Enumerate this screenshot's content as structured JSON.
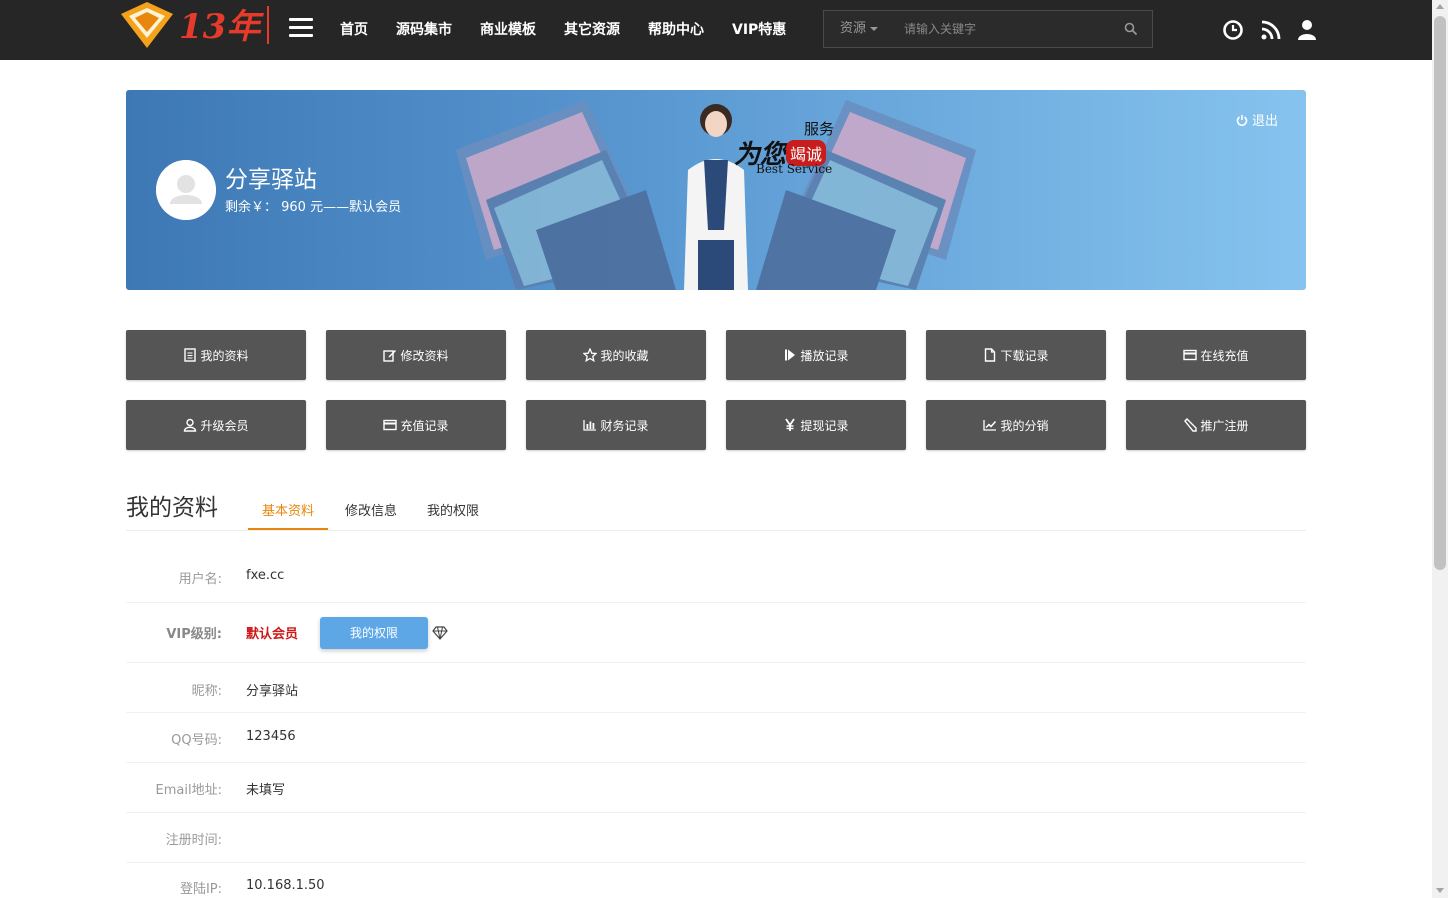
{
  "header": {
    "logo_text": "13年",
    "nav": [
      "首页",
      "源码集市",
      "商业模板",
      "其它资源",
      "帮助中心",
      "VIP特惠"
    ],
    "search": {
      "category": "资源",
      "placeholder": "请输入关键字"
    }
  },
  "banner": {
    "user_name": "分享驿站",
    "balance_text": "剩余￥： 960 元——默认会员",
    "logout_label": "退出",
    "slogan_line1": "服务",
    "slogan_line2": "为您",
    "slogan_badge": "竭诚",
    "slogan_line3": "Best Service"
  },
  "actions": [
    {
      "label": "我的资料",
      "icon": "document-icon"
    },
    {
      "label": "修改资料",
      "icon": "edit-icon"
    },
    {
      "label": "我的收藏",
      "icon": "star-icon"
    },
    {
      "label": "播放记录",
      "icon": "play-icon"
    },
    {
      "label": "下载记录",
      "icon": "file-icon"
    },
    {
      "label": "在线充值",
      "icon": "credit-card-icon"
    },
    {
      "label": "升级会员",
      "icon": "user-icon"
    },
    {
      "label": "充值记录",
      "icon": "credit-card-icon"
    },
    {
      "label": "财务记录",
      "icon": "bar-chart-icon"
    },
    {
      "label": "提现记录",
      "icon": "yen-icon"
    },
    {
      "label": "我的分销",
      "icon": "line-chart-icon"
    },
    {
      "label": "推广注册",
      "icon": "pencil-icon"
    }
  ],
  "section": {
    "title": "我的资料",
    "tabs": [
      "基本资料",
      "修改信息",
      "我的权限"
    ]
  },
  "profile": {
    "username_label": "用户名:",
    "username": "fxe.cc",
    "vip_label": "VIP级别:",
    "vip_level": "默认会员",
    "perm_button": "我的权限",
    "nickname_label": "昵称:",
    "nickname": "分享驿站",
    "qq_label": "QQ号码:",
    "qq": "123456",
    "email_label": "Email地址:",
    "email": "未填写",
    "regtime_label": "注册时间:",
    "regtime": "",
    "ip_label": "登陆IP:",
    "ip": "10.168.1.50"
  },
  "colors": {
    "topbar": "#262626",
    "button": "#555555",
    "accent": "#e8860d",
    "vip_red": "#d01818",
    "perm_blue": "#5ea7e7"
  }
}
